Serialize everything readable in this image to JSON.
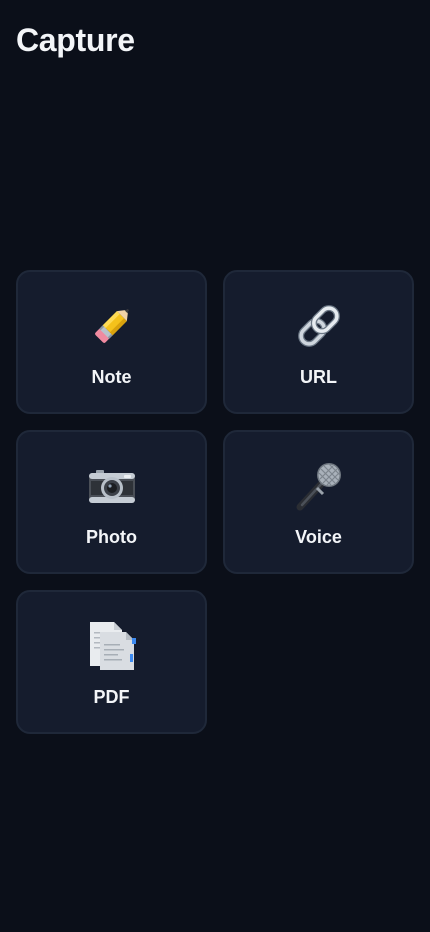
{
  "header": {
    "title": "Capture"
  },
  "capture_options": [
    {
      "label": "Note",
      "icon": "pencil-icon"
    },
    {
      "label": "URL",
      "icon": "link-icon"
    },
    {
      "label": "Photo",
      "icon": "camera-icon"
    },
    {
      "label": "Voice",
      "icon": "microphone-icon"
    },
    {
      "label": "PDF",
      "icon": "document-icon"
    }
  ],
  "colors": {
    "background": "#0b0f19",
    "card": "#151c2d",
    "card_border": "#1f2839",
    "text": "#f3f5f8"
  }
}
